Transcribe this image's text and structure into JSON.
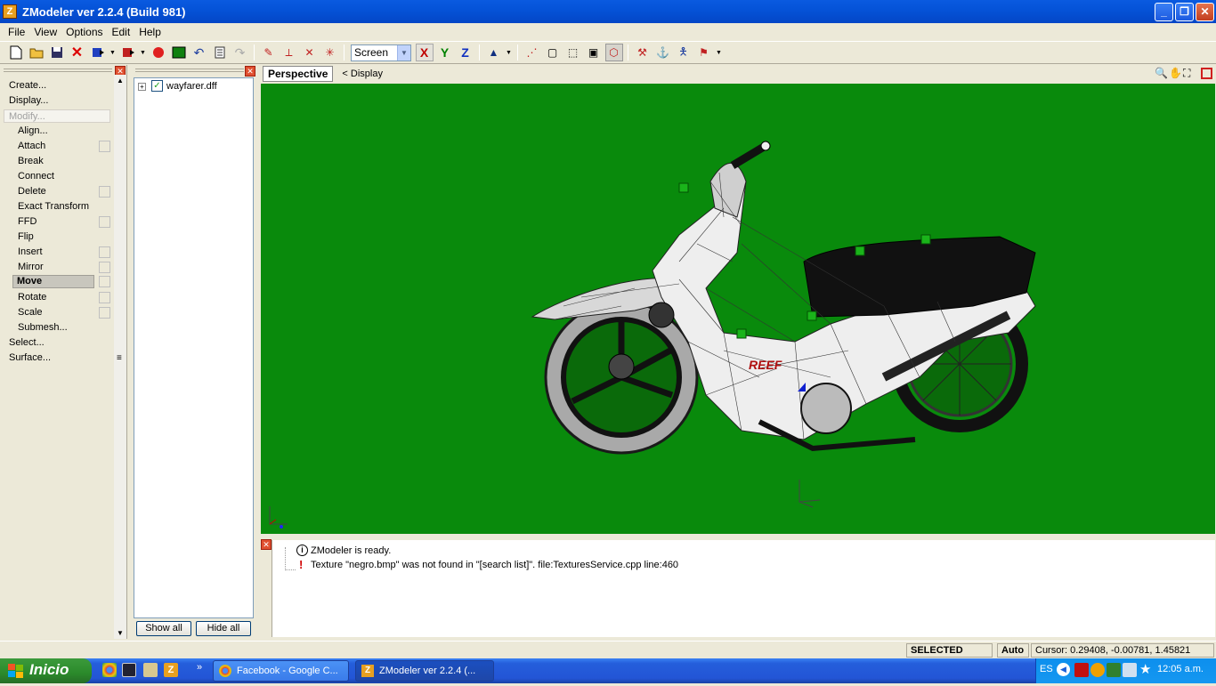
{
  "window": {
    "title": "ZModeler ver 2.2.4 (Build 981)",
    "icon": "Z"
  },
  "menu": [
    "File",
    "View",
    "Options",
    "Edit",
    "Help"
  ],
  "toolbar": {
    "view_select": "Screen",
    "axis_x": "X",
    "axis_y": "Y",
    "axis_z": "Z"
  },
  "commands": {
    "create": "Create...",
    "display": "Display...",
    "modify": "Modify...",
    "modify_items": [
      {
        "label": "Align...",
        "check": false
      },
      {
        "label": "Attach",
        "check": true
      },
      {
        "label": "Break",
        "check": false
      },
      {
        "label": "Connect",
        "check": false
      },
      {
        "label": "Delete",
        "check": true
      },
      {
        "label": "Exact Transform",
        "check": false
      },
      {
        "label": "FFD",
        "check": true
      },
      {
        "label": "Flip",
        "check": false
      },
      {
        "label": "Insert",
        "check": true
      },
      {
        "label": "Mirror",
        "check": true
      }
    ],
    "move": "Move",
    "after_move": [
      {
        "label": "Rotate",
        "check": true
      },
      {
        "label": "Scale",
        "check": true
      },
      {
        "label": "Submesh...",
        "check": false
      }
    ],
    "select": "Select...",
    "surface": "Surface..."
  },
  "tree": {
    "file": "wayfarer.dff",
    "show_all": "Show all",
    "hide_all": "Hide all"
  },
  "viewport": {
    "tab": "Perspective",
    "display_link": "< Display",
    "model_text": "REEF"
  },
  "log": {
    "line1": "ZModeler is ready.",
    "line2": "Texture \"negro.bmp\" was not found in \"[search list]\". file:TexturesService.cpp line:460"
  },
  "status": {
    "mode": "SELECTED MODE",
    "auto": "Auto",
    "cursor": "Cursor: 0.29408, -0.00781, 1.45821"
  },
  "taskbar": {
    "start": "Inicio",
    "tasks": [
      "Facebook - Google C...",
      "ZModeler ver 2.2.4 (..."
    ],
    "lang": "ES",
    "clock": "12:05 a.m."
  },
  "colors": {
    "viewport_bg": "#098a0c",
    "titlebar": "#0553d8",
    "taskbar": "#245edb",
    "start": "#2b8a2b"
  }
}
